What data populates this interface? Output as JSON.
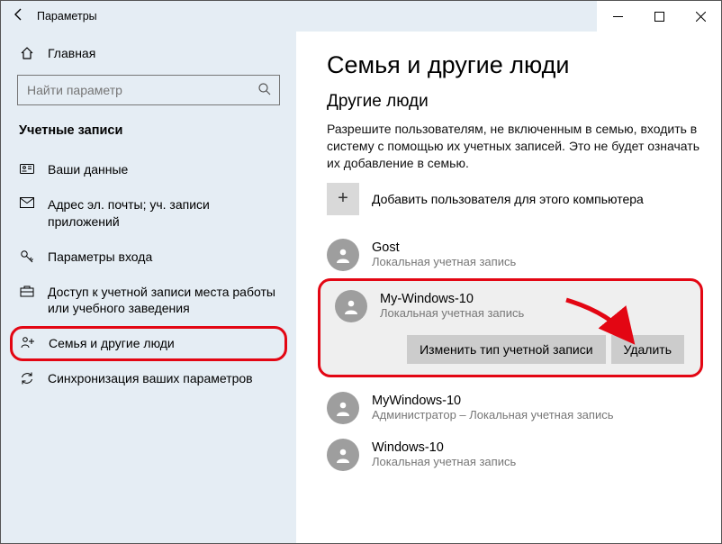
{
  "window": {
    "title": "Параметры"
  },
  "sidebar": {
    "home": "Главная",
    "search_placeholder": "Найти параметр",
    "category": "Учетные записи",
    "items": [
      {
        "label": "Ваши данные"
      },
      {
        "label": "Адрес эл. почты; уч. записи приложений"
      },
      {
        "label": "Параметры входа"
      },
      {
        "label": "Доступ к учетной записи места работы или учебного заведения"
      },
      {
        "label": "Семья и другие люди"
      },
      {
        "label": "Синхронизация ваших параметров"
      }
    ]
  },
  "content": {
    "heading": "Семья и другие люди",
    "subheading": "Другие люди",
    "description": "Разрешите пользователям, не включенным в семью, входить в систему с помощью их учетных записей. Это не будет означать их добавление в семью.",
    "add_label": "Добавить пользователя для этого компьютера",
    "users": [
      {
        "name": "Gost",
        "type": "Локальная учетная запись"
      },
      {
        "name": "My-Windows-10",
        "type": "Локальная учетная запись"
      },
      {
        "name": "MyWindows-10",
        "type": "Администратор – Локальная учетная запись"
      },
      {
        "name": "Windows-10",
        "type": "Локальная учетная запись"
      }
    ],
    "change_type_btn": "Изменить тип учетной записи",
    "remove_btn": "Удалить"
  }
}
